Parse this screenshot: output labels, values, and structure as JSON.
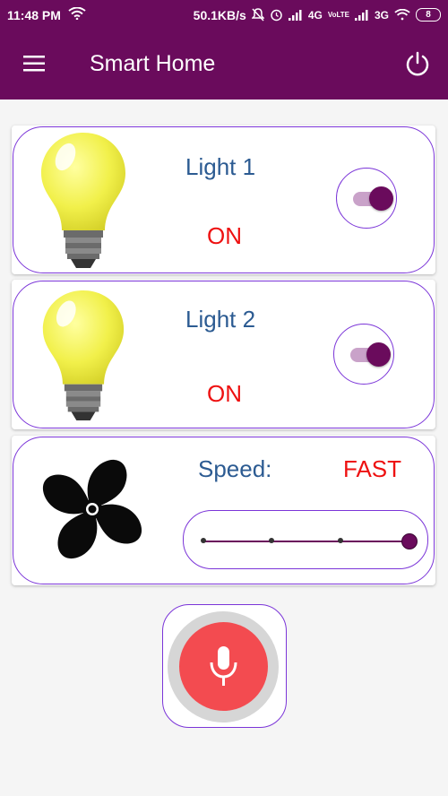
{
  "status_bar": {
    "time": "11:48 PM",
    "speed": "50.1KB/s",
    "network_1": "4G",
    "volte": "VoLTE",
    "network_2": "3G",
    "battery": "8"
  },
  "app_bar": {
    "title": "Smart Home",
    "menu_icon": "hamburger-menu-icon",
    "power_icon": "power-icon",
    "color": "#6a0b5c"
  },
  "devices": [
    {
      "name": "Light 1",
      "status": "ON",
      "icon": "light-bulb-icon",
      "enabled": true
    },
    {
      "name": "Light 2",
      "status": "ON",
      "icon": "light-bulb-icon",
      "enabled": true
    }
  ],
  "fan": {
    "label": "Speed:",
    "value": "FAST",
    "icon": "fan-icon",
    "slider_level": 1.0,
    "slider_steps": 4
  },
  "mic": {
    "icon": "microphone-icon"
  },
  "colors": {
    "accent": "#6a0b5c",
    "outline": "#7b35d8",
    "title_text": "#2c5b92",
    "status_text": "#ee1111",
    "mic_button": "#f34b50"
  }
}
